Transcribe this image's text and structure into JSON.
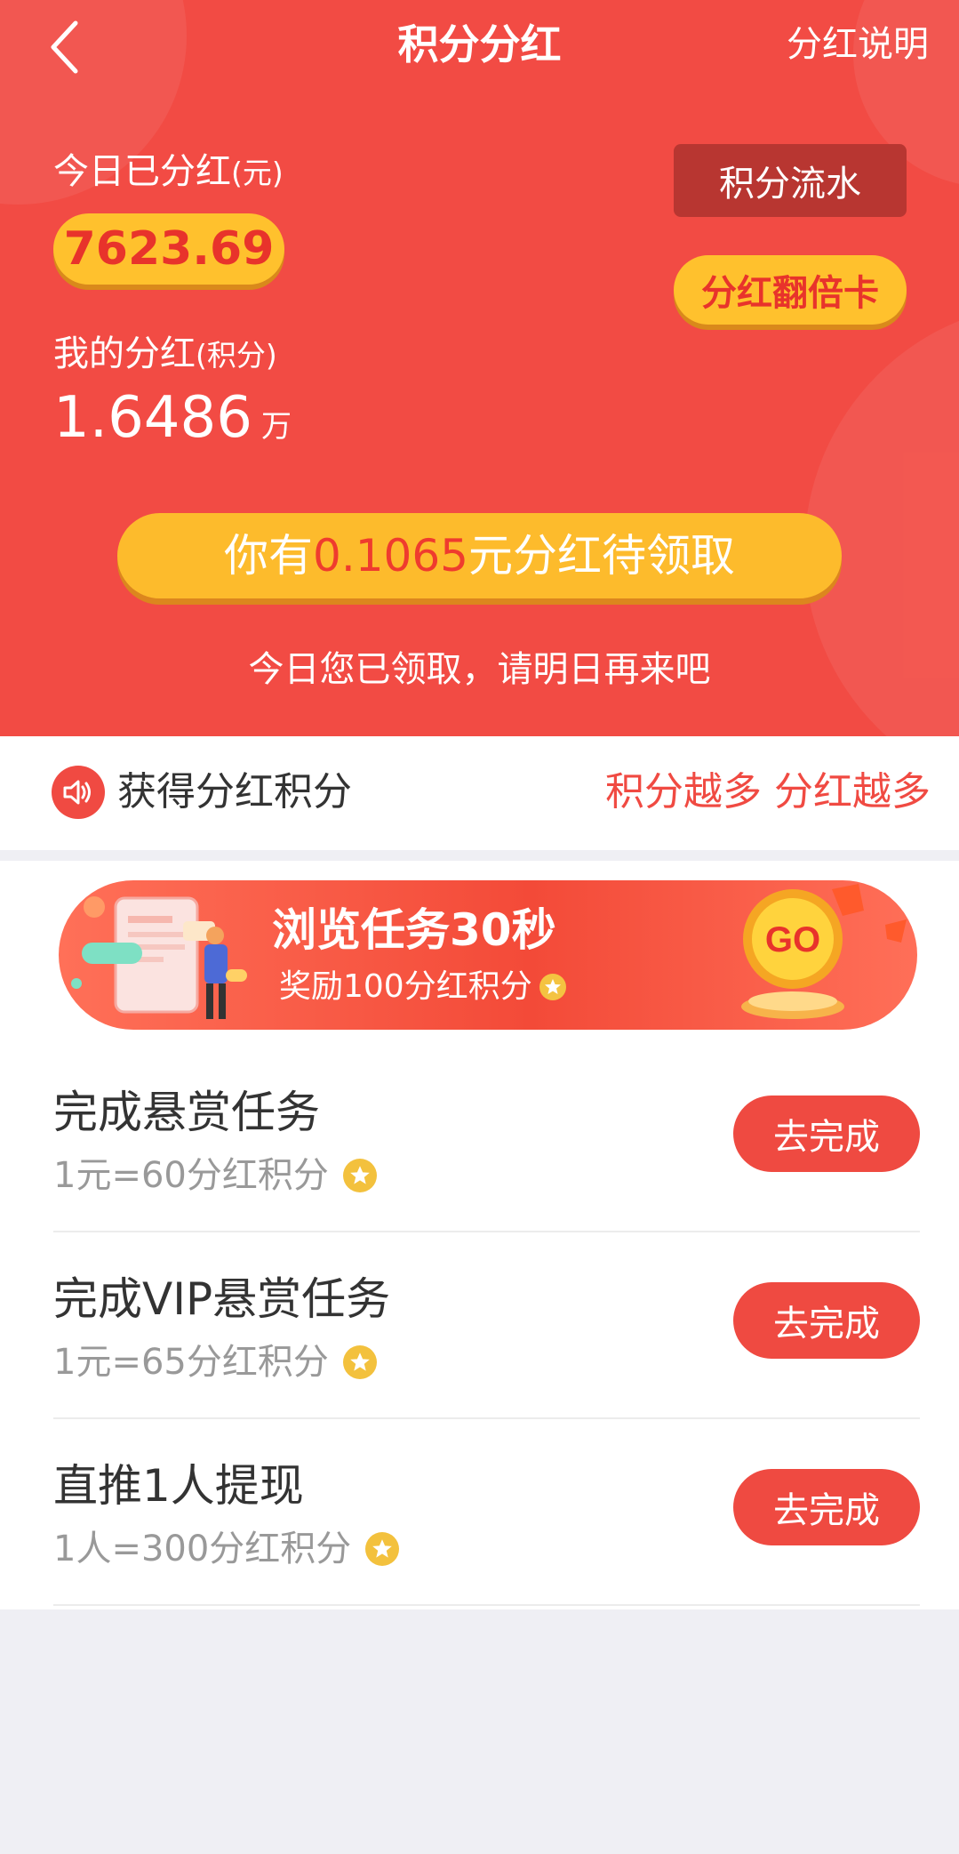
{
  "header": {
    "title": "积分分红",
    "explain_link": "分红说明"
  },
  "summary": {
    "today_label": "今日已分红",
    "today_unit": "(元)",
    "today_value": "7623.69",
    "my_label": "我的分红",
    "my_unit": "(积分)",
    "my_value": "1.6486",
    "my_value_unit": "万",
    "flow_button": "积分流水",
    "double_card_button": "分红翻倍卡"
  },
  "claim": {
    "prefix": "你有",
    "amount": "0.1065",
    "suffix": "元分红待领取",
    "note": "今日您已领取，请明日再来吧"
  },
  "earn": {
    "title": "获得分红积分",
    "slogan": "积分越多 分红越多"
  },
  "banner": {
    "title": "浏览任务30秒",
    "subtitle": "奖励100分红积分",
    "go_label": "GO"
  },
  "tasks": [
    {
      "title": "完成悬赏任务",
      "desc": "1元=60分红积分",
      "button": "去完成"
    },
    {
      "title": "完成VIP悬赏任务",
      "desc": "1元=65分红积分",
      "button": "去完成"
    },
    {
      "title": "直推1人提现",
      "desc": "1人=300分红积分",
      "button": "去完成"
    }
  ],
  "colors": {
    "brand_red": "#f24b44",
    "gold": "#ffc12d",
    "button_red": "#ef4a41"
  }
}
